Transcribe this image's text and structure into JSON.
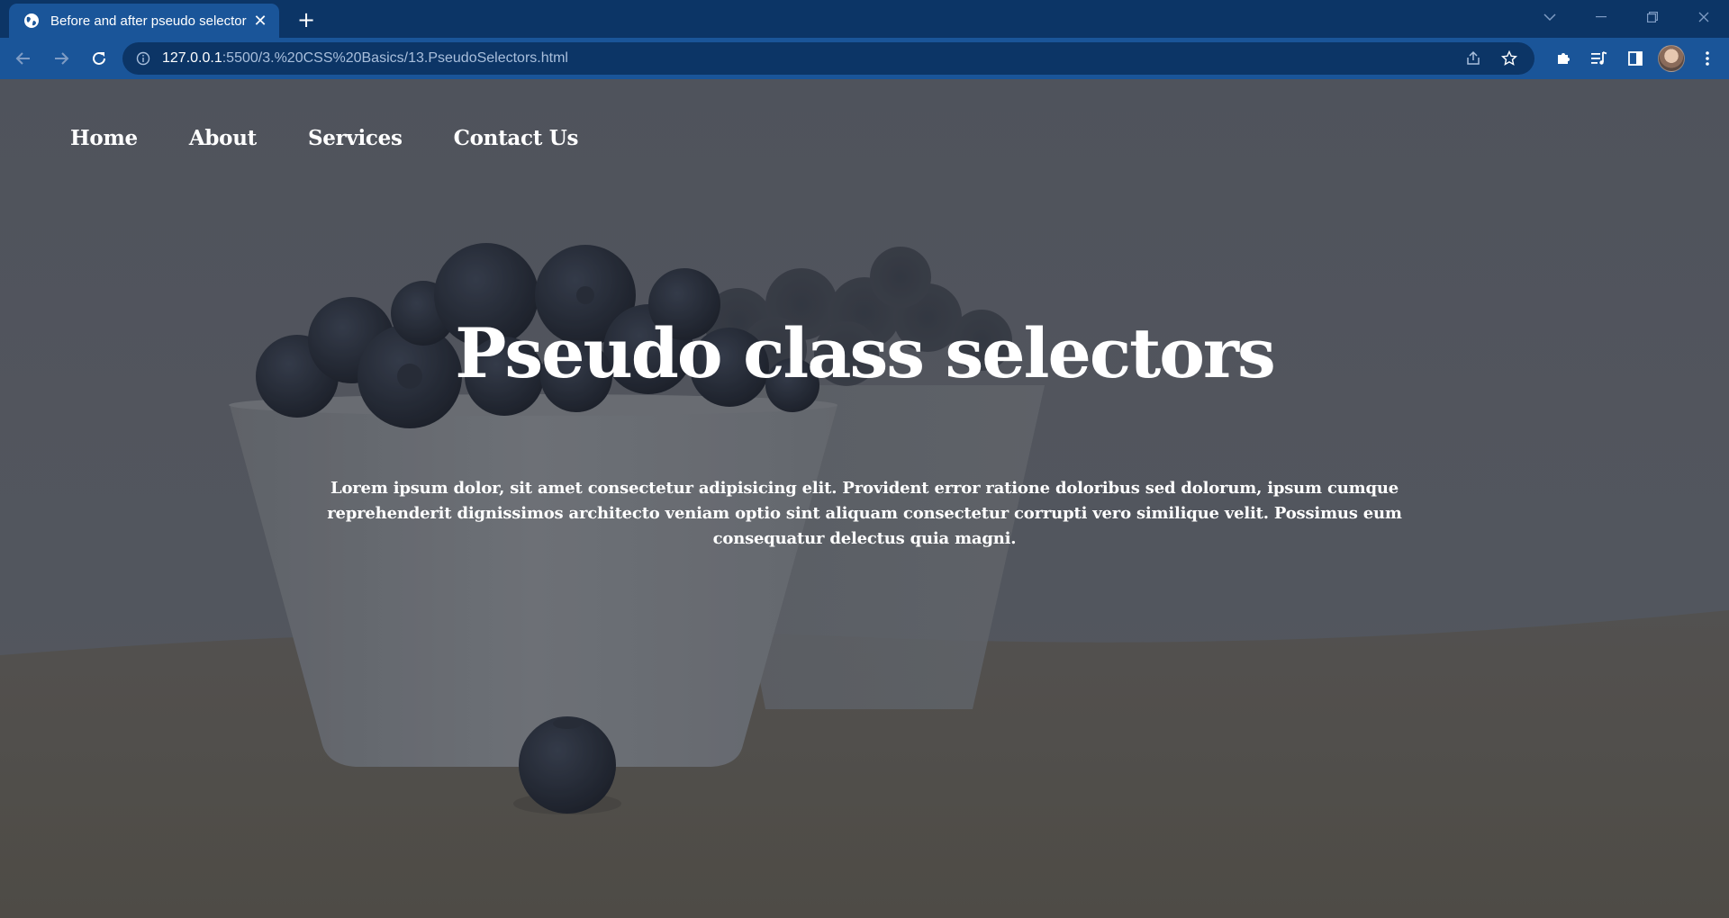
{
  "browser": {
    "tab": {
      "title": "Before and after pseudo selector",
      "close": "✕"
    },
    "new_tab": "+",
    "window_controls": [
      "⌄",
      "—",
      "❐",
      "✕"
    ],
    "url": {
      "host": "127.0.0.1",
      "rest": ":5500/3.%20CSS%20Basics/13.PseudoSelectors.html"
    }
  },
  "page": {
    "nav": [
      "Home",
      "About",
      "Services",
      "Contact Us"
    ],
    "title": "Pseudo class selectors",
    "paragraph": "Lorem ipsum dolor, sit amet consectetur adipisicing elit. Provident error ratione doloribus sed dolorum, ipsum cumque reprehenderit dignissimos architecto veniam optio sint aliquam consectetur corrupti vero similique velit. Possimus eum consequatur delectus quia magni."
  },
  "colors": {
    "tabstrip": "#0c3566",
    "toolbar": "#1a5599",
    "text": "#ffffff"
  }
}
